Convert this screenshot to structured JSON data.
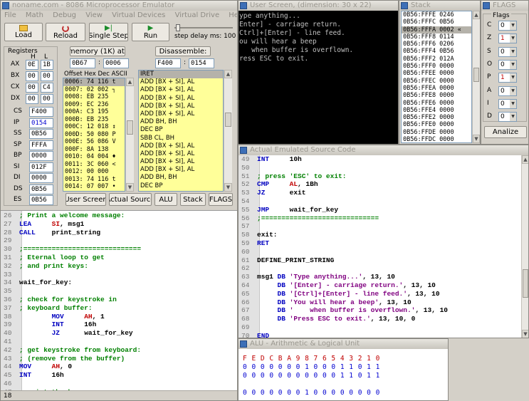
{
  "main": {
    "title": "noname.com - 8086 Microprocessor Emulator",
    "menu": [
      "File",
      "Math",
      "Debug",
      "View",
      "Virtual Devices",
      "Virtual Drive",
      "Help"
    ],
    "toolbar": {
      "load": "Load",
      "reload": "Reload",
      "single_step": "Single Step",
      "run": "Run",
      "step_delay": "step delay ms: 100"
    },
    "registers_label": "Registers",
    "reg_h": "H",
    "reg_l": "L",
    "regs8": [
      {
        "name": "AX",
        "h": "0E",
        "l": "1B"
      },
      {
        "name": "BX",
        "h": "00",
        "l": "00"
      },
      {
        "name": "CX",
        "h": "00",
        "l": "C4"
      },
      {
        "name": "DX",
        "h": "00",
        "l": "00"
      }
    ],
    "regs16": [
      {
        "name": "CS",
        "value": "F400"
      },
      {
        "name": "IP",
        "value": "0154"
      },
      {
        "name": "SS",
        "value": "0B56"
      },
      {
        "name": "SP",
        "value": "FFFA"
      },
      {
        "name": "BP",
        "value": "0000"
      },
      {
        "name": "SI",
        "value": "012F"
      },
      {
        "name": "DI",
        "value": "0000"
      },
      {
        "name": "DS",
        "value": "0B56"
      },
      {
        "name": "ES",
        "value": "0B56"
      }
    ],
    "memory_btn": "memory (1K) at:",
    "mem_seg": "0B67",
    "mem_off": "0006",
    "disasm_btn": "Disassemble:",
    "dis_seg": "F400",
    "dis_off": "0154",
    "mem_header": "Offset  Hex  Dec ASCII",
    "memory_rows": [
      "0006: 74 116 t",
      "0007: 02 002 ┐",
      "0008: EB 235",
      "0009: EC 236",
      "000A: C3 195",
      "000B: EB 235",
      "000C: 12 018 ↕",
      "000D: 50 080 P",
      "000E: 56 086 V",
      "000F: 8A 138",
      "0010: 04 004 ♦",
      "0011: 3C 060 <",
      "0012: 00 000",
      "0013: 74 116 t",
      "0014: 07 007 •"
    ],
    "disasm_rows": [
      "IRET",
      "ADD [BX + SI], AL",
      "ADD [BX + SI], AL",
      "ADD [BX + SI], AL",
      "ADD [BX + SI], AL",
      "ADD [BX + SI], AL",
      "ADD BH, BH",
      "DEC BP",
      "SBB CL, BH",
      "ADD [BX + SI], AL",
      "ADD [BX + SI], AL",
      "ADD [BX + SI], AL",
      "ADD [BX + SI], AL",
      "ADD BH, BH",
      "DEC BP"
    ],
    "bottom_buttons": [
      "User Screen",
      "Actual Source",
      "ALU",
      "Stack",
      "FLAGS"
    ],
    "status": "18"
  },
  "source_left": [
    {
      "n": "26",
      "t": "; Print a welcome message:",
      "c": "cm"
    },
    {
      "n": "27",
      "parts": [
        [
          "LEA",
          "kw"
        ],
        [
          "     ",
          ""
        ],
        [
          "SI",
          "reg"
        ],
        [
          ", msg1",
          "plain"
        ]
      ]
    },
    {
      "n": "28",
      "parts": [
        [
          "CALL",
          "kw"
        ],
        [
          "    print_string",
          "plain"
        ]
      ]
    },
    {
      "n": "29",
      "t": "",
      "c": ""
    },
    {
      "n": "30",
      "t": ";=============================",
      "c": "cm"
    },
    {
      "n": "31",
      "t": "; Eternal loop to get",
      "c": "cm"
    },
    {
      "n": "32",
      "t": "; and print keys:",
      "c": "cm"
    },
    {
      "n": "33",
      "t": "",
      "c": ""
    },
    {
      "n": "34",
      "t": "wait_for_key:",
      "c": "lab"
    },
    {
      "n": "35",
      "t": "",
      "c": ""
    },
    {
      "n": "36",
      "t": "; check for keystroke in",
      "c": "cm"
    },
    {
      "n": "37",
      "t": "; keyboard buffer:",
      "c": "cm"
    },
    {
      "n": "38",
      "parts": [
        [
          "        ",
          ""
        ],
        [
          "MOV",
          "kw"
        ],
        [
          "     ",
          ""
        ],
        [
          "AH",
          "reg"
        ],
        [
          ", 1",
          "plain"
        ]
      ]
    },
    {
      "n": "39",
      "parts": [
        [
          "        ",
          ""
        ],
        [
          "INT",
          "kw"
        ],
        [
          "     16h",
          "plain"
        ]
      ]
    },
    {
      "n": "40",
      "parts": [
        [
          "        ",
          ""
        ],
        [
          "JZ",
          "kw"
        ],
        [
          "      wait_for_key",
          "plain"
        ]
      ]
    },
    {
      "n": "41",
      "t": "",
      "c": ""
    },
    {
      "n": "42",
      "t": "; get keystroke from keyboard:",
      "c": "cm"
    },
    {
      "n": "43",
      "t": "; (remove from the buffer)",
      "c": "cm"
    },
    {
      "n": "44",
      "parts": [
        [
          "MOV",
          "kw"
        ],
        [
          "     ",
          ""
        ],
        [
          "AH",
          "reg"
        ],
        [
          ", 0",
          "plain"
        ]
      ]
    },
    {
      "n": "45",
      "parts": [
        [
          "INT",
          "kw"
        ],
        [
          "     16h",
          "plain"
        ]
      ]
    },
    {
      "n": "46",
      "t": "",
      "c": ""
    },
    {
      "n": "47",
      "t": "; print the key:",
      "c": "cm"
    }
  ],
  "user_screen": {
    "title": "User Screen, (dimension: 30 x 22)",
    "lines": [
      "ype anything...",
      "Enter] - carriage return.",
      "Ctrl]+[Enter] - line feed.",
      "ou will hear a beep",
      "   when buffer is overflown.",
      "ress ESC to exit."
    ]
  },
  "stack": {
    "title": "Stack",
    "rows": [
      "0B56:FFFE 0246",
      "0B56:FFFC 0B56",
      "0B56:FFFA 0002 «",
      "0B56:FFF8 0114",
      "0B56:FFF6 0206",
      "0B56:FFF4 0B56",
      "0B56:FFF2 012A",
      "0B56:FFF0 0000",
      "0B56:FFEE 0000",
      "0B56:FFEC 0000",
      "0B56:FFEA 0000",
      "0B56:FFE8 0000",
      "0B56:FFE6 0000",
      "0B56:FFE4 0000",
      "0B56:FFE2 0000",
      "0B56:FFE0 0000",
      "0B56:FFDE 0000",
      "0B56:FFDC 0000"
    ]
  },
  "flags": {
    "title": "FLAGS",
    "label": "Flags",
    "items": [
      {
        "name": "C",
        "value": "0"
      },
      {
        "name": "Z",
        "value": "1"
      },
      {
        "name": "S",
        "value": "0"
      },
      {
        "name": "O",
        "value": "0"
      },
      {
        "name": "P",
        "value": "1"
      },
      {
        "name": "A",
        "value": "0"
      },
      {
        "name": "I",
        "value": "0"
      },
      {
        "name": "D",
        "value": "0"
      }
    ],
    "analyze": "Analize"
  },
  "source_right": {
    "title": "Actual Emulated Source Code",
    "lines": [
      {
        "n": "49",
        "parts": [
          [
            "INT",
            "kw"
          ],
          [
            "     10h",
            "plain"
          ]
        ]
      },
      {
        "n": "50",
        "t": "",
        "c": ""
      },
      {
        "n": "51",
        "t": "; press 'ESC' to exit:",
        "c": "cm"
      },
      {
        "n": "52",
        "parts": [
          [
            "CMP",
            "kw"
          ],
          [
            "     ",
            ""
          ],
          [
            "AL",
            "reg"
          ],
          [
            ", 1Bh",
            "plain"
          ]
        ]
      },
      {
        "n": "53",
        "parts": [
          [
            "JZ",
            "kw"
          ],
          [
            "      exit",
            "plain"
          ]
        ]
      },
      {
        "n": "54",
        "t": "",
        "c": ""
      },
      {
        "n": "55",
        "parts": [
          [
            "JMP",
            "kw"
          ],
          [
            "     wait_for_key",
            "plain"
          ]
        ]
      },
      {
        "n": "56",
        "t": ";=============================",
        "c": "cm"
      },
      {
        "n": "57",
        "t": "",
        "c": ""
      },
      {
        "n": "58",
        "t": "exit:",
        "c": "lab"
      },
      {
        "n": "59",
        "parts": [
          [
            "RET",
            "kw"
          ]
        ]
      },
      {
        "n": "60",
        "t": "",
        "c": ""
      },
      {
        "n": "61",
        "t": "DEFINE_PRINT_STRING",
        "c": "lab"
      },
      {
        "n": "62",
        "t": "",
        "c": ""
      },
      {
        "n": "63",
        "parts": [
          [
            "msg1 ",
            "plain"
          ],
          [
            "DB",
            "kw"
          ],
          [
            " ",
            ""
          ],
          [
            "'Type anything...'",
            "str"
          ],
          [
            ", 13, 10",
            "plain"
          ]
        ]
      },
      {
        "n": "64",
        "parts": [
          [
            "     ",
            ""
          ],
          [
            "DB",
            "kw"
          ],
          [
            " ",
            ""
          ],
          [
            "'[Enter] - carriage return.'",
            "str"
          ],
          [
            ", 13, 10",
            "plain"
          ]
        ]
      },
      {
        "n": "65",
        "parts": [
          [
            "     ",
            ""
          ],
          [
            "DB",
            "kw"
          ],
          [
            " ",
            ""
          ],
          [
            "'[Ctrl]+[Enter] - line feed.'",
            "str"
          ],
          [
            ", 13, 10",
            "plain"
          ]
        ]
      },
      {
        "n": "66",
        "parts": [
          [
            "     ",
            ""
          ],
          [
            "DB",
            "kw"
          ],
          [
            " ",
            ""
          ],
          [
            "'You will hear a beep'",
            "str"
          ],
          [
            ", 13, 10",
            "plain"
          ]
        ]
      },
      {
        "n": "67",
        "parts": [
          [
            "     ",
            ""
          ],
          [
            "DB",
            "kw"
          ],
          [
            " ",
            ""
          ],
          [
            "'    when buffer is overflown.'",
            "str"
          ],
          [
            ", 13, 10",
            "plain"
          ]
        ]
      },
      {
        "n": "68",
        "parts": [
          [
            "     ",
            ""
          ],
          [
            "DB",
            "kw"
          ],
          [
            " ",
            ""
          ],
          [
            "'Press ESC to exit.'",
            "str"
          ],
          [
            ", 13, 10, 0",
            "plain"
          ]
        ]
      },
      {
        "n": "69",
        "t": "",
        "c": ""
      },
      {
        "n": "70",
        "t": "END",
        "c": "kw"
      },
      {
        "n": "71",
        "t": "",
        "c": ""
      }
    ]
  },
  "alu": {
    "title": "ALU - Arithmetic & Logical Unit",
    "header": "F E D C B A 9 8 7 6 5 4 3 2 1 0",
    "row1": "0 0 0 0 0 0 0 1 0 0 0 1 1 0 1 1",
    "row2": "0 0 0 0 0 0 0 0 0 0 0 1 1 0 1 1",
    "row3": "0 0 0 0 0 0 0 1 0 0 0 0 0 0 0 0"
  }
}
